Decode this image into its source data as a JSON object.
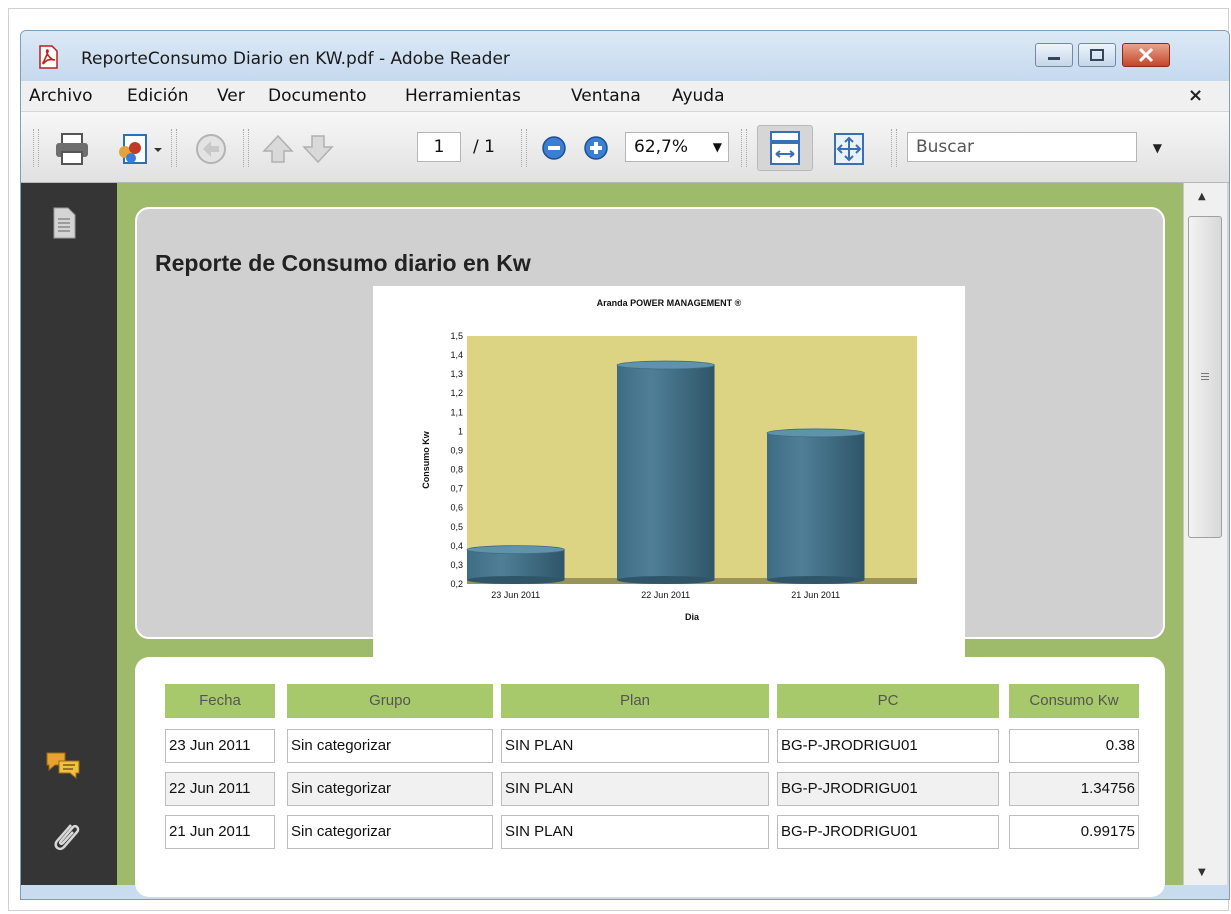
{
  "window": {
    "title": "ReporteConsumo Diario en KW.pdf - Adobe Reader"
  },
  "menu": [
    "Archivo",
    "Edición",
    "Ver",
    "Documento",
    "Herramientas",
    "Ventana",
    "Ayuda"
  ],
  "menu_close": "×",
  "toolbar": {
    "page_current": "1",
    "page_total": "/ 1",
    "zoom": "62,7%",
    "search_placeholder": "Buscar"
  },
  "report": {
    "title": "Reporte de Consumo diario en Kw",
    "table_headers": [
      "Fecha",
      "Grupo",
      "Plan",
      "PC",
      "Consumo Kw"
    ],
    "rows": [
      [
        "23 Jun 2011",
        "Sin categorizar",
        "SIN PLAN",
        "BG-P-JRODRIGU01",
        "0.38"
      ],
      [
        "22 Jun 2011",
        "Sin categorizar",
        "SIN PLAN",
        "BG-P-JRODRIGU01",
        "1.34756"
      ],
      [
        "21 Jun 2011",
        "Sin categorizar",
        "SIN PLAN",
        "BG-P-JRODRIGU01",
        "0.99175"
      ]
    ]
  },
  "chart_data": {
    "type": "bar",
    "title": "Aranda POWER MANAGEMENT ®",
    "xlabel": "Dia",
    "ylabel": "Consumo Kw",
    "categories": [
      "23 Jun 2011",
      "22 Jun 2011",
      "21 Jun 2011"
    ],
    "values": [
      0.38,
      1.34756,
      0.99175
    ],
    "ylim": [
      0.2,
      1.5
    ],
    "yticks": [
      "0,2",
      "0,3",
      "0,4",
      "0,5",
      "0,6",
      "0,7",
      "0,8",
      "0,9",
      "1",
      "1,1",
      "1,2",
      "1,3",
      "1,4",
      "1,5"
    ],
    "legend": "none",
    "colors": {
      "plot_bg": "#dcd482",
      "bar": "#4f7f97",
      "floor": "#9a9458"
    }
  },
  "colors": {
    "panel_green": "#9dbb6b",
    "header_green": "#a7c96b",
    "left_panel": "#353535"
  }
}
